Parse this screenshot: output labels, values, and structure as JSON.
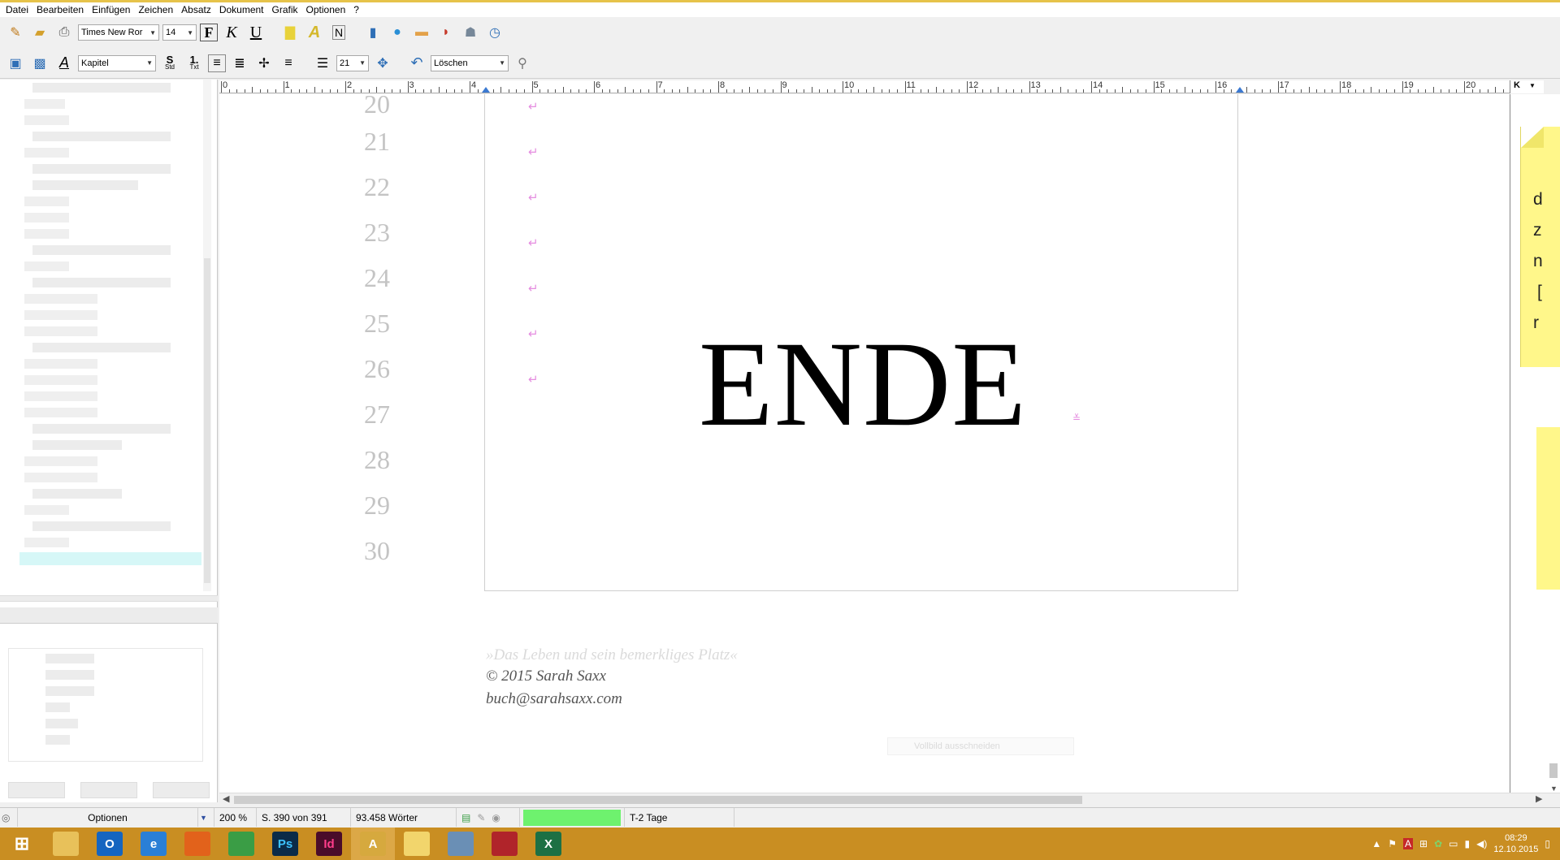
{
  "menu": [
    "Datei",
    "Bearbeiten",
    "Einfügen",
    "Zeichen",
    "Absatz",
    "Dokument",
    "Grafik",
    "Optionen",
    "?"
  ],
  "toolbar1": {
    "font": "Times New Ror",
    "size": "14",
    "bold": "F",
    "italic": "K",
    "underline": "U"
  },
  "toolbar2": {
    "style": "Kapitel",
    "std": "S",
    "std_sub": "Std",
    "txt": "1.",
    "txt_sub": "Txt",
    "spacing": "21",
    "delete": "Löschen"
  },
  "ruler": {
    "labels": [
      "0",
      "1",
      "2",
      "3",
      "4",
      "5",
      "6",
      "7",
      "8",
      "9",
      "10",
      "11",
      "12",
      "13",
      "14",
      "15",
      "16",
      "17",
      "18",
      "19",
      "20"
    ],
    "corner": "K"
  },
  "document": {
    "line_numbers": [
      "20",
      "21",
      "22",
      "23",
      "24",
      "25",
      "26",
      "27",
      "28",
      "29",
      "30"
    ],
    "para_mark": "↵",
    "end_text": "ENDE",
    "end_mark": "≚",
    "footer_faded": "»Das Leben und sein bemerkliges Platz«",
    "copyright": "© 2015 Sarah Saxx",
    "email": "buch@sarahsaxx.com",
    "ghost_button": "Vollbild ausschneiden"
  },
  "sticky_letters": [
    "d",
    "z",
    "n",
    "[",
    "r"
  ],
  "status": {
    "options": "Optionen",
    "zoom": "200 %",
    "page": "S. 390 von 391",
    "words": "93.458 Wörter",
    "deadline": "T-2 Tage"
  },
  "taskbar": {
    "apps": [
      {
        "name": "windows-start",
        "label": "",
        "color": "#c98e22"
      },
      {
        "name": "file-explorer",
        "label": "",
        "color": "#e8c15a"
      },
      {
        "name": "outlook",
        "label": "O",
        "color": "#1565c0"
      },
      {
        "name": "internet-explorer",
        "label": "e",
        "color": "#2a7fd6"
      },
      {
        "name": "firefox",
        "label": "",
        "color": "#e2621b"
      },
      {
        "name": "chrome",
        "label": "",
        "color": "#3a9d45"
      },
      {
        "name": "photoshop",
        "label": "Ps",
        "color": "#0b2b48"
      },
      {
        "name": "indesign",
        "label": "Id",
        "color": "#4a0c2a"
      },
      {
        "name": "papyrus",
        "label": "A",
        "color": "#d6a93e"
      },
      {
        "name": "notes",
        "label": "",
        "color": "#f2d56c"
      },
      {
        "name": "calculator",
        "label": "",
        "color": "#6a8fb5"
      },
      {
        "name": "audio-recorder",
        "label": "",
        "color": "#b0242a"
      },
      {
        "name": "excel",
        "label": "X",
        "color": "#1d7044"
      }
    ],
    "time": "08:29",
    "date": "12.10.2015"
  },
  "colors": {
    "taskbar": "#c98e22",
    "sticky": "#fff78a",
    "progress": "#6ef26e",
    "para_mark": "#e58de0"
  }
}
